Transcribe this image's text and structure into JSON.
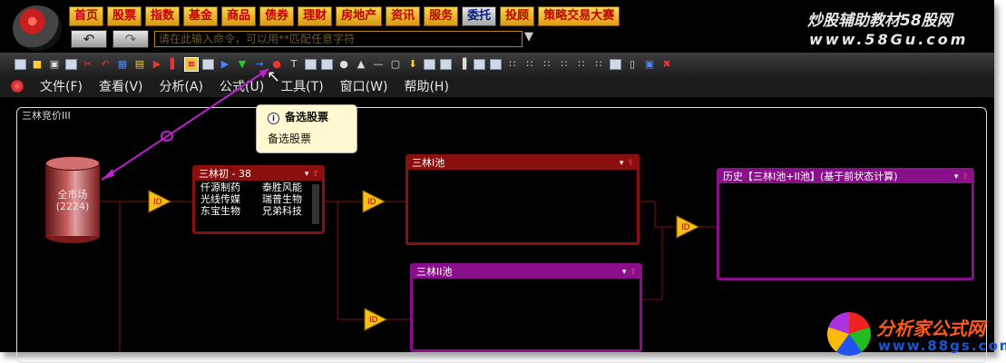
{
  "nav": [
    "首页",
    "股票",
    "指数",
    "基金",
    "商品",
    "债券",
    "理财",
    "房地产",
    "资讯",
    "服务",
    "委托",
    "投顾",
    "策略交易大赛"
  ],
  "nav_active_index": 10,
  "command": {
    "placeholder": "请在此输入命令，可以用**匹配任意字符"
  },
  "watermark_top": {
    "line1": "炒股辅助教材58股网",
    "line2": "www.58Gu.com"
  },
  "menu": [
    "文件(F)",
    "查看(V)",
    "分析(A)",
    "公式(U)",
    "工具(T)",
    "窗口(W)",
    "帮助(H)"
  ],
  "canvas": {
    "title": "三林竞价III",
    "market": {
      "label": "全市场",
      "count": "(2224)"
    },
    "pool_initial": {
      "title": "三林初 - 38",
      "stocks": [
        "仟源制药",
        "泰胜风能",
        "光线传媒",
        "瑞普生物",
        "东宝生物",
        "兄弟科技"
      ]
    },
    "pool_1": {
      "title": "三林I池"
    },
    "pool_2": {
      "title": "三林II池"
    },
    "history": {
      "title": "历史【三林I池+II池】(基于前状态计算)"
    }
  },
  "tooltip": {
    "title": "备选股票",
    "body": "备选股票"
  },
  "watermark_bottom": {
    "line1": "分析家公式网",
    "line2": "www.88gs.com"
  },
  "colors": {
    "red_pool": "#8a1010",
    "purple_pool": "#8a0f8a",
    "connector": "#b040d0",
    "nav_button": "#f0c030"
  }
}
